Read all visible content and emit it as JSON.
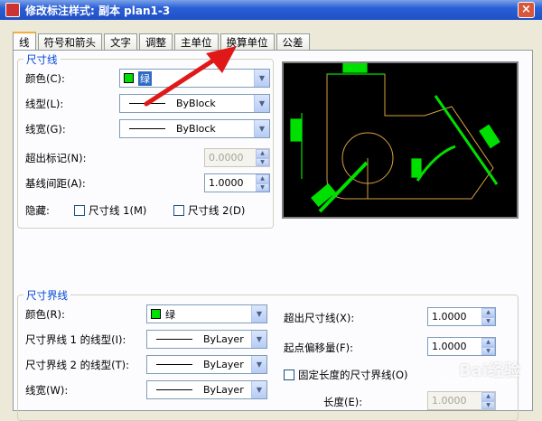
{
  "window": {
    "title": "修改标注样式: 副本 plan1-3",
    "close": "×"
  },
  "tabs": [
    "线",
    "符号和箭头",
    "文字",
    "调整",
    "主单位",
    "换算单位",
    "公差"
  ],
  "dim_lines": {
    "title": "尺寸线",
    "color_label": "颜色(C):",
    "color_value": "绿",
    "linetype_label": "线型(L):",
    "linetype_value": "ByBlock",
    "lineweight_label": "线宽(G):",
    "lineweight_value": "ByBlock",
    "extend_ticks_label": "超出标记(N):",
    "extend_ticks_value": "0.0000",
    "baseline_spacing_label": "基线间距(A):",
    "baseline_spacing_value": "1.0000",
    "suppress_label": "隐藏:",
    "suppress_dim1": "尺寸线 1(M)",
    "suppress_dim2": "尺寸线 2(D)"
  },
  "ext_lines": {
    "title": "尺寸界线",
    "color_label": "颜色(R):",
    "color_value": "绿",
    "linetype1_label": "尺寸界线 1 的线型(I):",
    "linetype1_value": "ByLayer",
    "linetype2_label": "尺寸界线 2 的线型(T):",
    "linetype2_value": "ByLayer",
    "lineweight_label": "线宽(W):",
    "lineweight_value": "ByLayer",
    "extend_beyond_label": "超出尺寸线(X):",
    "extend_beyond_value": "1.0000",
    "offset_label": "起点偏移量(F):",
    "offset_value": "1.0000",
    "fixed_length_label": "固定长度的尺寸界线(O)",
    "length_label": "长度(E):",
    "length_value": "1.0000"
  },
  "watermark": {
    "main": "Bai经验",
    "sub": "jingyan.baidu.com"
  },
  "colors": {
    "accent_green": "#00e000",
    "group_title": "#0046d5",
    "arrow": "#e01818"
  }
}
